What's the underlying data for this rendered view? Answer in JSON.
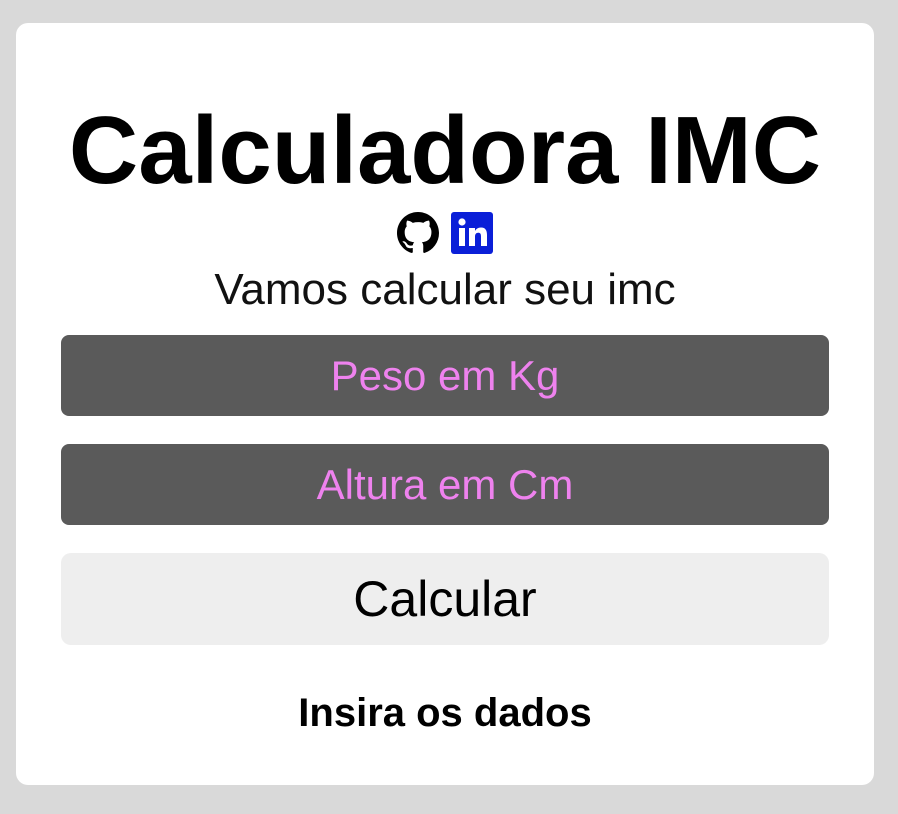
{
  "app": {
    "title": "Calculadora IMC",
    "subtitle": "Vamos calcular seu imc"
  },
  "social_icons": [
    {
      "icon": "github-icon",
      "color": "#000000"
    },
    {
      "icon": "linkedin-icon",
      "color": "#0a1fd8"
    }
  ],
  "form": {
    "weight_placeholder": "Peso em Kg",
    "height_placeholder": "Altura em Cm",
    "weight_value": "",
    "height_value": "",
    "submit_label": "Calcular"
  },
  "result": {
    "message": "Insira os dados"
  },
  "colors": {
    "page_background": "#d9d9d9",
    "card_background": "#ffffff",
    "input_background": "#5a5a5a",
    "input_text": "#ee82ee",
    "button_background": "#eeeeee"
  }
}
